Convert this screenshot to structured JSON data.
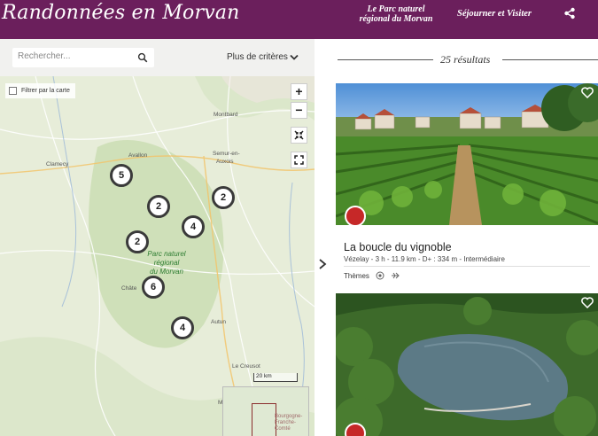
{
  "header": {
    "brand": "Randonnées en Morvan",
    "nav_parc_line1": "Le Parc naturel",
    "nav_parc_line2": "régional du Morvan",
    "nav_sejour": "Séjourner et Visiter",
    "accent": "#6b1f5c"
  },
  "search": {
    "placeholder": "Rechercher...",
    "more_criteria": "Plus de critères"
  },
  "map": {
    "filter_label": "Filtrer par la carte",
    "zoom_in": "+",
    "zoom_out": "−",
    "clusters": [
      "5",
      "2",
      "2",
      "4",
      "2",
      "6",
      "4"
    ],
    "places": [
      "Montbard",
      "Avallon",
      "Clamecy",
      "Semur-en-",
      "Auxois",
      "Châte",
      "Autun",
      "Le Creusot",
      "M",
      "Bourgogne-",
      "Franche-",
      "Comté"
    ],
    "parc_label_1": "Parc naturel",
    "parc_label_2": "régional",
    "parc_label_3": "du Morvan",
    "scale": "20 km"
  },
  "results": {
    "count": "25 résultats",
    "cards": [
      {
        "title": "La boucle du vignoble",
        "meta": "Vézelay  -  3 h  -  11.9 km  -  D+ : 334 m  -  Intermédiaire",
        "themes_label": "Thèmes",
        "badge_color": "#c62828"
      },
      {
        "badge_color": "#c62828"
      }
    ]
  }
}
